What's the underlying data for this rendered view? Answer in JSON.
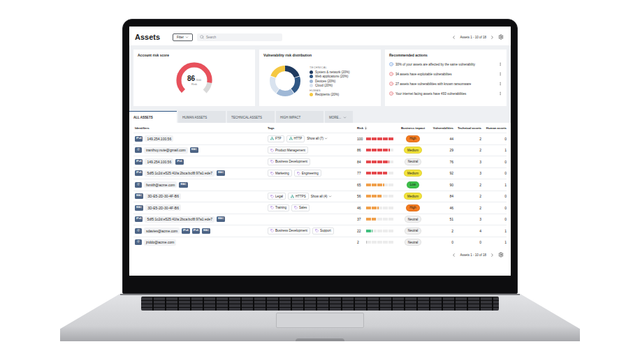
{
  "header": {
    "title": "Assets",
    "filter": "Filter",
    "search": {
      "placeholder": "Search"
    },
    "pagination": "Assets 1 - 10 of 18"
  },
  "risk_card": {
    "title": "Account risk score",
    "score": "86",
    "max": "/100",
    "label": "Risk",
    "level": 0.86,
    "color": "#e8505b"
  },
  "distribution_card": {
    "title": "Vulnerability risk distribution",
    "groups": [
      {
        "label": "TECHNICAL",
        "items": [
          {
            "label": "System & network (20%)",
            "value": 20,
            "color": "#1f3a5f"
          },
          {
            "label": "Web applications (20%)",
            "value": 20,
            "color": "#2f5785"
          },
          {
            "label": "Devices (20%)",
            "value": 20,
            "color": "#9fb8d6"
          },
          {
            "label": "Cloud (20%)",
            "value": 20,
            "color": "#d9e3ef"
          }
        ]
      },
      {
        "label": "HUMAN",
        "items": [
          {
            "label": "Recipients (20%)",
            "value": 20,
            "color": "#f5c842"
          }
        ]
      }
    ]
  },
  "actions_card": {
    "title": "Recommended actions",
    "items": [
      {
        "text": "30% of your assets are affected by the same vulnerability",
        "kind": "info"
      },
      {
        "text": "34 assets have exploitable vulnerabilites",
        "kind": "alert"
      },
      {
        "text": "27 assets have vulnerabilities with known ransomware",
        "kind": "alert"
      },
      {
        "text": "Your internet facing assets have 493 vulnerabilities",
        "kind": "alert"
      }
    ]
  },
  "tabs": [
    {
      "label": "ALL ASSETS",
      "selected": true
    },
    {
      "label": "HUMAN ASSETS",
      "selected": false
    },
    {
      "label": "TECHNICAL ASSETS",
      "selected": false
    },
    {
      "label": "HIGH IMPACT",
      "selected": false
    },
    {
      "label": "MORE...",
      "selected": false
    }
  ],
  "table": {
    "columns": [
      {
        "label": "Identifiers",
        "sorted": false
      },
      {
        "label": "Tags",
        "sorted": false
      },
      {
        "label": "Risk",
        "sorted": true
      },
      {
        "label": "Business impact",
        "sorted": false
      },
      {
        "label": "Vulnerabilities",
        "sorted": false
      },
      {
        "label": "Technical assets",
        "sorted": false
      },
      {
        "label": "Human assets",
        "sorted": false
      }
    ],
    "rows": [
      {
        "id_type": "IPv4",
        "value": "149.254.100.56",
        "extra_types": [],
        "tags": [
          {
            "label": "FTP",
            "kind": "protocol"
          },
          {
            "label": "HTTP",
            "kind": "protocol"
          }
        ],
        "more": "Show all (7)",
        "risk": {
          "value": "100",
          "level": 1.0,
          "color": "#e5484d"
        },
        "impact": {
          "label": "High",
          "color": "#f47b20"
        },
        "vulnerabilities": "44",
        "technical": "2",
        "human": "0"
      },
      {
        "id_type": "@",
        "value": "tranthuy.nute@gmail.com",
        "extra_types": [
          "MAC"
        ],
        "tags": [
          {
            "label": "Product Management",
            "kind": "department"
          }
        ],
        "more": "",
        "risk": {
          "value": "86",
          "level": 0.86,
          "color": "#e5484d"
        },
        "impact": {
          "label": "Medium",
          "color": "#f2e33a"
        },
        "vulnerabilities": "29",
        "technical": "2",
        "human": "1"
      },
      {
        "id_type": "IPv4",
        "value": "149.254.100.56",
        "extra_types": [
          "IPv6"
        ],
        "tags": [
          {
            "label": "Business Development",
            "kind": "department"
          }
        ],
        "more": "",
        "risk": {
          "value": "84",
          "level": 0.84,
          "color": "#e5484d"
        },
        "impact": {
          "label": "Neutral",
          "color": "#f1f1f1"
        },
        "vulnerabilities": "76",
        "technical": "3",
        "human": "0"
      },
      {
        "id_type": "IPv6",
        "value": "5df5:1c2d:e525:41fa:2bca:bcf8:97a1:ede7",
        "extra_types": [
          "MAC"
        ],
        "tags": [
          {
            "label": "Marketing",
            "kind": "department"
          },
          {
            "label": "Engineering",
            "kind": "department"
          }
        ],
        "more": "",
        "risk": {
          "value": "77",
          "level": 0.77,
          "color": "#e5484d"
        },
        "impact": {
          "label": "Medium",
          "color": "#f2e33a"
        },
        "vulnerabilities": "92",
        "technical": "3",
        "human": "0"
      },
      {
        "id_type": "@",
        "value": "fsmith@acme.com",
        "extra_types": [
          "MAC"
        ],
        "tags": [],
        "more": "",
        "risk": {
          "value": "65",
          "level": 0.65,
          "color": "#f0a04b"
        },
        "impact": {
          "label": "Low",
          "color": "#3dbf4a"
        },
        "vulnerabilities": "90",
        "technical": "2",
        "human": "1"
      },
      {
        "id_type": "MAC",
        "value": "3D-E5-2D-30-4F-B6",
        "extra_types": [],
        "tags": [
          {
            "label": "Legal",
            "kind": "department"
          },
          {
            "label": "HTTPS",
            "kind": "protocol"
          }
        ],
        "more": "Show all (4)",
        "risk": {
          "value": "56",
          "level": 0.56,
          "color": "#f0a04b"
        },
        "impact": {
          "label": "Medium",
          "color": "#f2e33a"
        },
        "vulnerabilities": "84",
        "technical": "2",
        "human": "0"
      },
      {
        "id_type": "MAC",
        "value": "3D-E5-2D-30-4F-B6",
        "extra_types": [],
        "tags": [
          {
            "label": "Training",
            "kind": "department"
          },
          {
            "label": "Sales",
            "kind": "department"
          }
        ],
        "more": "",
        "risk": {
          "value": "46",
          "level": 0.46,
          "color": "#f0a04b"
        },
        "impact": {
          "label": "High",
          "color": "#f47b20"
        },
        "vulnerabilities": "46",
        "technical": "2",
        "human": "0"
      },
      {
        "id_type": "IPv6",
        "value": "5df5:1c2d:e525:41fa:2bca:bcf8:97a1:ede7",
        "extra_types": [
          "MAC"
        ],
        "tags": [],
        "more": "",
        "risk": {
          "value": "37",
          "level": 0.37,
          "color": "#f0a04b"
        },
        "impact": {
          "label": "Neutral",
          "color": "#f1f1f1"
        },
        "vulnerabilities": "51",
        "technical": "3",
        "human": "0"
      },
      {
        "id_type": "@",
        "value": "sdavies@acme.com",
        "extra_types": [
          "IPv4",
          "IPv6",
          "MAC"
        ],
        "tags": [
          {
            "label": "Business Development",
            "kind": "department"
          },
          {
            "label": "Support",
            "kind": "department"
          }
        ],
        "more": "",
        "risk": {
          "value": "22",
          "level": 0.22,
          "color": "#3fbf7f"
        },
        "impact": {
          "label": "Neutral",
          "color": "#f1f1f1"
        },
        "vulnerabilities": "2",
        "technical": "4",
        "human": "1"
      },
      {
        "id_type": "@",
        "value": "jriddo@acme.com",
        "extra_types": [],
        "tags": [],
        "more": "",
        "risk": {
          "value": "2",
          "level": 0.02,
          "color": "#bdbdbd"
        },
        "impact": {
          "label": "Neutral",
          "color": "#f1f1f1"
        },
        "vulnerabilities": "0",
        "technical": "0",
        "human": "1"
      }
    ]
  },
  "footer": {
    "pagination": "Assets 1 - 10 of 18"
  }
}
